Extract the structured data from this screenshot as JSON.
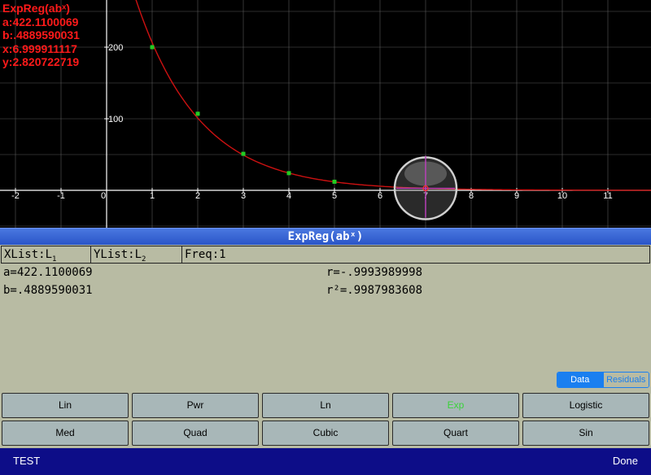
{
  "readout": {
    "title": "ExpReg(abˣ)",
    "a": "a:422.1100069",
    "b": "b:.4889590031",
    "x": "x:6.999911117",
    "y": "y:2.820722719"
  },
  "axis": {
    "x_ticks": [
      "-2",
      "-1",
      "0",
      "1",
      "2",
      "3",
      "4",
      "5",
      "6",
      "7",
      "8",
      "9",
      "10",
      "11"
    ],
    "y_ticks": [
      "200",
      "100"
    ]
  },
  "chart_data": {
    "type": "scatter",
    "points": [
      [
        1,
        200
      ],
      [
        2,
        107
      ],
      [
        3,
        51
      ],
      [
        4,
        24
      ],
      [
        5,
        12
      ]
    ],
    "curve": {
      "a": 422.1100069,
      "b": 0.4889590031
    },
    "xlim": [
      -2.3,
      12.2
    ],
    "ylim": [
      -50,
      270
    ],
    "trace_x": 7
  },
  "panel": {
    "title": "ExpReg(abˣ)",
    "xlist": "XList:L",
    "xlist_sub": "1",
    "ylist": "YList:L",
    "ylist_sub": "2",
    "freq": "Freq:1",
    "a_result": "a=422.1100069",
    "b_result": "b=.4889590031",
    "r_result": "r=-.9993989998",
    "r2_result": "r²=.9987983608"
  },
  "toggle": {
    "data": "Data",
    "residuals": "Residuals"
  },
  "regression_buttons": [
    "Lin",
    "Pwr",
    "Ln",
    "Exp",
    "Logistic",
    "Med",
    "Quad",
    "Cubic",
    "Quart",
    "Sin"
  ],
  "selected_button": "Exp",
  "bottom": {
    "test": "TEST",
    "done": "Done"
  },
  "colors": {
    "curve": "#cc1111",
    "points": "#22cc22",
    "readout": "#ff1a1a",
    "title_bar": "#3564d4",
    "bottom_bar": "#0d0d88"
  }
}
